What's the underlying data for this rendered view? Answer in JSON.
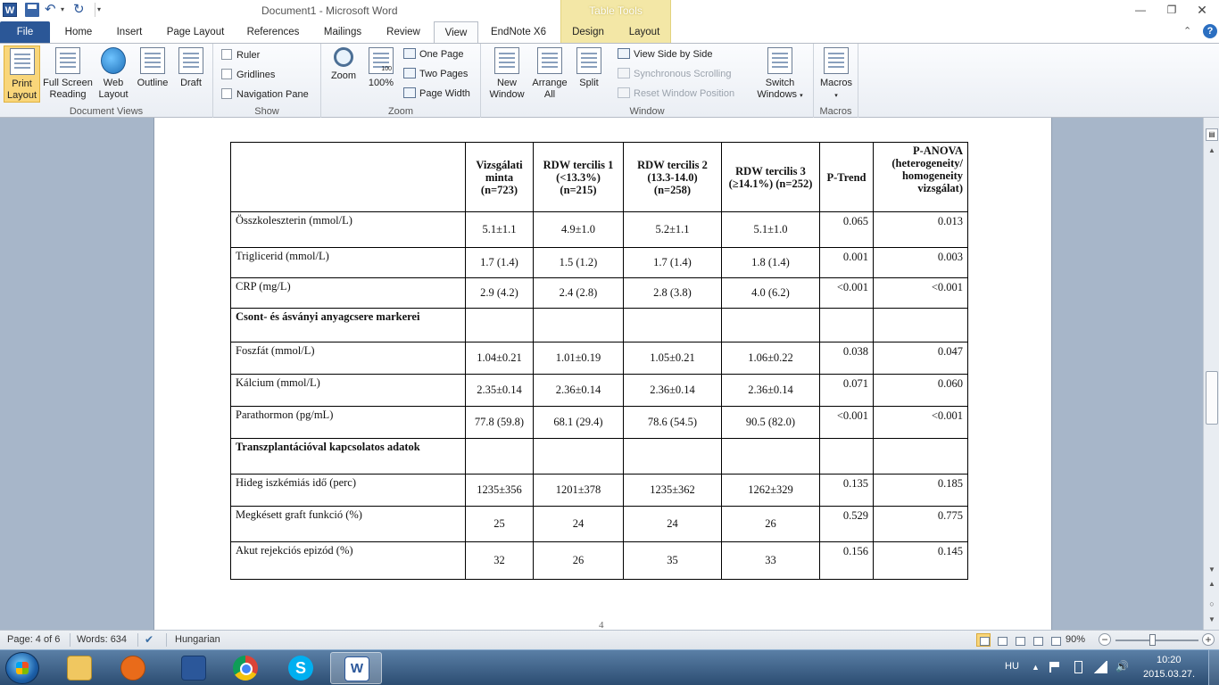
{
  "titlebar": {
    "title": "Document1 - Microsoft Word",
    "contextual_tab_group": "Table Tools"
  },
  "tabs": [
    "File",
    "Home",
    "Insert",
    "Page Layout",
    "References",
    "Mailings",
    "Review",
    "View",
    "EndNote X6",
    "Design",
    "Layout"
  ],
  "ribbon": {
    "document_views": {
      "label": "Document Views",
      "buttons": [
        [
          "Print",
          "Layout"
        ],
        [
          "Full Screen",
          "Reading"
        ],
        [
          "Web",
          "Layout"
        ],
        [
          "Outline",
          ""
        ],
        [
          "Draft",
          ""
        ]
      ]
    },
    "show": {
      "label": "Show",
      "items": [
        "Ruler",
        "Gridlines",
        "Navigation Pane"
      ]
    },
    "zoom": {
      "label": "Zoom",
      "zoom_btn": "Zoom",
      "pct_btn": "100%",
      "pct_icon_text": "100",
      "small": [
        "One Page",
        "Two Pages",
        "Page Width"
      ]
    },
    "window": {
      "label": "Window",
      "new_window": [
        "New",
        "Window"
      ],
      "arrange_all": [
        "Arrange",
        "All"
      ],
      "split": "Split",
      "small": [
        "View Side by Side",
        "Synchronous Scrolling",
        "Reset Window Position"
      ],
      "switch_windows": [
        "Switch",
        "Windows"
      ]
    },
    "macros": {
      "label": "Macros",
      "btn": "Macros"
    }
  },
  "table": {
    "headers": [
      "",
      "Vizsgálati minta (n=723)",
      "RDW tercilis 1 (<13.3%) (n=215)",
      "RDW tercilis 2 (13.3-14.0) (n=258)",
      "RDW tercilis 3 (≥14.1%) (n=252)",
      "P-Trend",
      "P-ANOVA (heterogeneity/ homogeneity vizsgálat)"
    ],
    "rows": [
      {
        "label": "Összkoleszterin  (mmol/L)",
        "values": [
          "5.1±1.1",
          "4.9±1.0",
          "5.2±1.1",
          "5.1±1.0"
        ],
        "ptrend": "0.065",
        "panova": "0.013"
      },
      {
        "label": "Triglicerid (mmol/L)",
        "values": [
          "1.7 (1.4)",
          "1.5 (1.2)",
          "1.7 (1.4)",
          "1.8 (1.4)"
        ],
        "ptrend": "0.001",
        "panova": "0.003"
      },
      {
        "label": "CRP (mg/L)",
        "values": [
          "2.9 (4.2)",
          "2.4 (2.8)",
          "2.8 (3.8)",
          "4.0 (6.2)"
        ],
        "ptrend": "<0.001",
        "panova": "<0.001"
      },
      {
        "section": "Csont- és ásványi anyagcsere markerei"
      },
      {
        "label": "Foszfát (mmol/L)",
        "values": [
          "1.04±0.21",
          "1.01±0.19",
          "1.05±0.21",
          "1.06±0.22"
        ],
        "ptrend": "0.038",
        "panova": "0.047"
      },
      {
        "label": "Kálcium (mmol/L)",
        "values": [
          "2.35±0.14",
          "2.36±0.14",
          "2.36±0.14",
          "2.36±0.14"
        ],
        "ptrend": "0.071",
        "panova": "0.060"
      },
      {
        "label": "Parathormon (pg/mL)",
        "values": [
          "77.8 (59.8)",
          "68.1 (29.4)",
          "78.6 (54.5)",
          "90.5 (82.0)"
        ],
        "ptrend": "<0.001",
        "panova": "<0.001"
      },
      {
        "section": "Transzplantációval  kapcsolatos adatok"
      },
      {
        "label": "Hideg iszkémiás idő (perc)",
        "values": [
          "1235±356",
          "1201±378",
          "1235±362",
          "1262±329"
        ],
        "ptrend": "0.135",
        "panova": "0.185"
      },
      {
        "label": "Megkésett  graft funkció (%)",
        "values": [
          "25",
          "24",
          "24",
          "26"
        ],
        "ptrend": "0.529",
        "panova": "0.775"
      },
      {
        "label": "Akut rejekciós epizód (%)",
        "values": [
          "32",
          "26",
          "35",
          "33"
        ],
        "ptrend": "0.156",
        "panova": "0.145"
      }
    ]
  },
  "page_number": "4",
  "statusbar": {
    "page": "Page: 4 of 6",
    "words": "Words: 634",
    "language": "Hungarian",
    "zoom": "90%",
    "zoom_value": 90
  },
  "taskbar": {
    "lang": "HU",
    "time": "10:20",
    "date": "2015.03.27."
  },
  "colors": {
    "file_tab": "#2b5797",
    "active_view": "#f9d67a",
    "doc_background": "#a7b6c9"
  }
}
